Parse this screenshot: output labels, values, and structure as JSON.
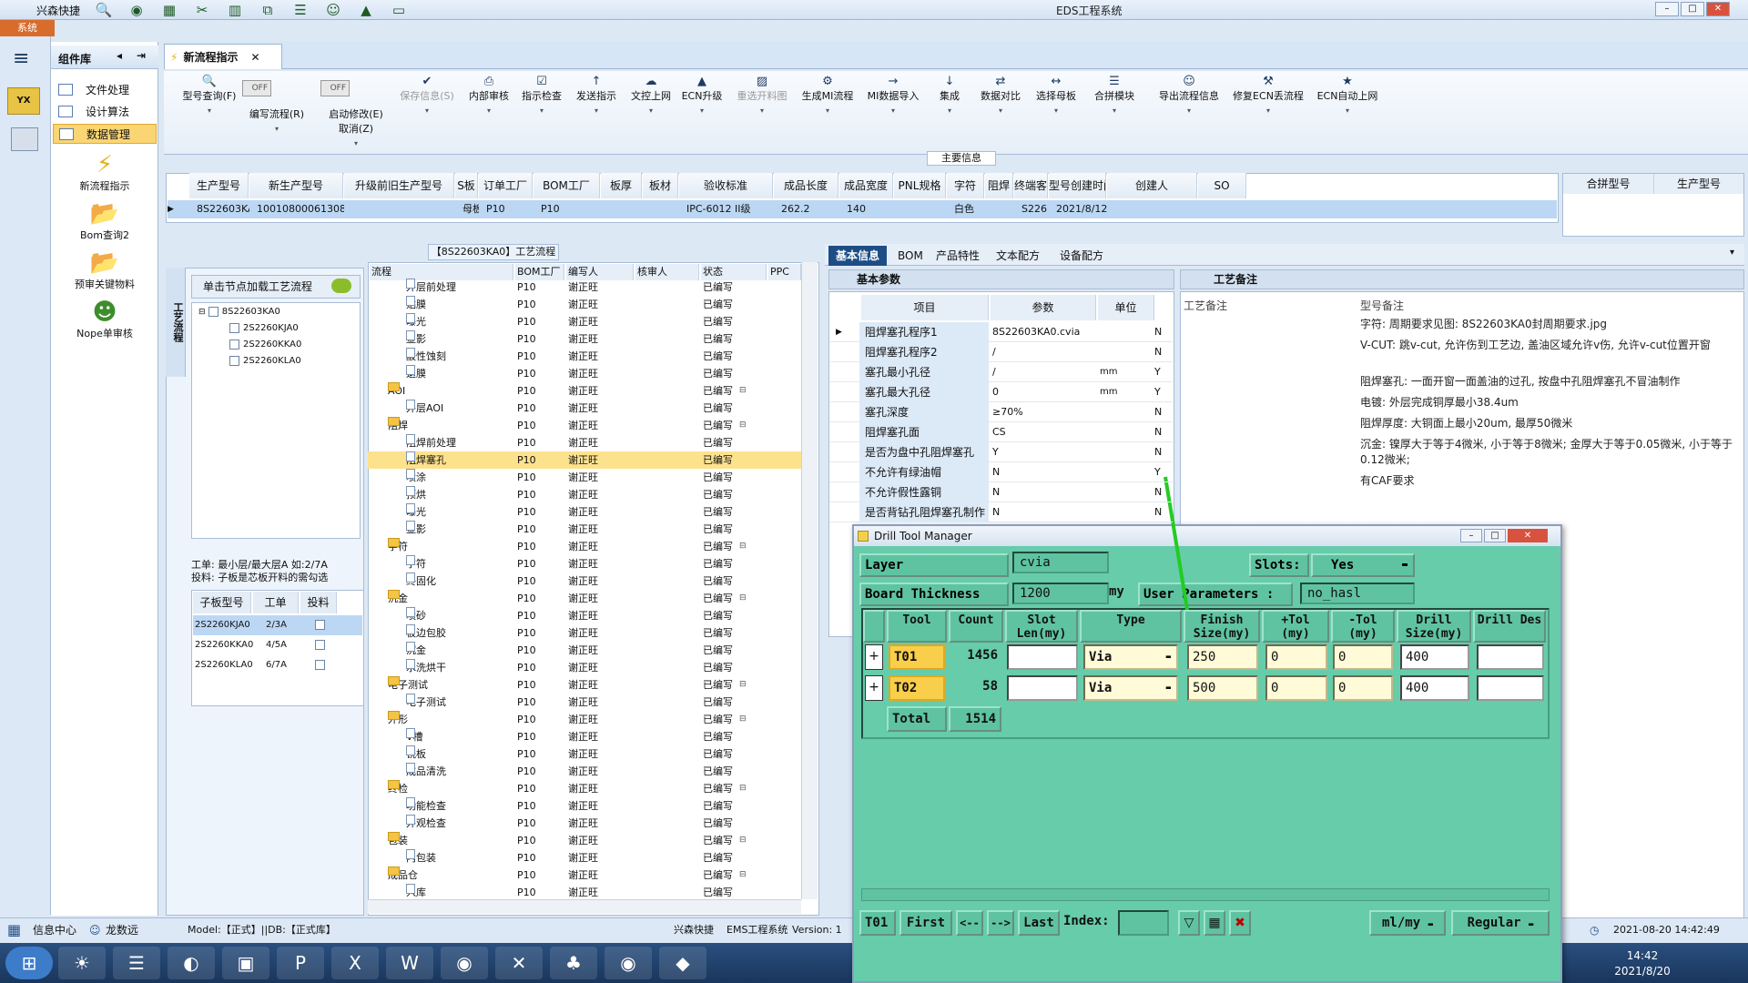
{
  "window": {
    "title": "EDS工程系统",
    "app_menu_label": "兴森快捷",
    "system_tab": "系统"
  },
  "left_panel": {
    "title": "组件库",
    "nav": [
      {
        "label": "文件处理"
      },
      {
        "label": "设计算法"
      },
      {
        "label": "数据管理"
      }
    ],
    "big_items": [
      {
        "label": "新流程指示"
      },
      {
        "label": "Bom查询2"
      },
      {
        "label": "预审关键物料"
      },
      {
        "label": "Nope单审核"
      }
    ]
  },
  "doc_tab": {
    "label": "新流程指示"
  },
  "ribbon": {
    "buttons": [
      {
        "label": "型号查询(F)"
      },
      {
        "label": "编写流程(R)"
      },
      {
        "label": "启动修改(E)",
        "sub": "取消(Z)"
      },
      {
        "label": "保存信息(S)"
      },
      {
        "label": "内部审核"
      },
      {
        "label": "指示检查"
      },
      {
        "label": "发送指示"
      },
      {
        "label": "文控上网"
      },
      {
        "label": "ECN升级"
      },
      {
        "label": "重选开料图"
      },
      {
        "label": "生成MI流程"
      },
      {
        "label": "MI数据导入"
      },
      {
        "label": "集成"
      },
      {
        "label": "数据对比"
      },
      {
        "label": "选择母板"
      },
      {
        "label": "合拼模块"
      },
      {
        "label": "导出流程信息"
      },
      {
        "label": "修复ECN丢流程"
      },
      {
        "label": "ECN自动上网"
      }
    ],
    "toggle_off": "OFF",
    "section_label": "主要信息"
  },
  "main_grid": {
    "headers": [
      "生产型号",
      "新生产型号",
      "升级前旧生产型号",
      "S板",
      "订单工厂",
      "BOM工厂",
      "板厚",
      "板材",
      "验收标准",
      "成品长度",
      "成品宽度",
      "PNL规格",
      "字符",
      "阻焊",
      "终端客户代码",
      "型号创建时间",
      "创建人",
      "SO"
    ],
    "row": [
      "8S22603KA0",
      "10010800061308",
      "",
      "母板",
      "P10",
      "P10",
      "",
      "",
      "IPC-6012 II级",
      "262.2",
      "140",
      "",
      "白色",
      "",
      "S226",
      "2021/8/12",
      "",
      ""
    ]
  },
  "merge_grid": {
    "headers": [
      "合拼型号",
      "生产型号"
    ]
  },
  "tree_panel": {
    "vertical_label": "工艺流程",
    "load_button": "单击节点加载工艺流程",
    "root": "8S22603KA0",
    "children": [
      "2S2260KJA0",
      "2S2260KKA0",
      "2S2260KLA0"
    ],
    "memo": "工单: 最小层/最大层A 如:2/7A\n投料: 子板是芯板开料的需勾选",
    "sub_headers": [
      "子板型号",
      "工单",
      "投料"
    ],
    "sub_rows": [
      {
        "model": "2S2260KJA0",
        "order": "2/3A"
      },
      {
        "model": "2S2260KKA0",
        "order": "4/5A"
      },
      {
        "model": "2S2260KLA0",
        "order": "6/7A"
      }
    ]
  },
  "flow": {
    "title": "【8S22603KA0】工艺流程",
    "headers": [
      "流程",
      "BOM工厂",
      "编写人",
      "核审人",
      "状态",
      "PPC"
    ],
    "rows": [
      {
        "name": "外层前处理",
        "kind": "leaf",
        "f": "P10",
        "w": "谢正旺",
        "s": "已编写"
      },
      {
        "name": "贴膜",
        "kind": "leaf",
        "f": "P10",
        "w": "谢正旺",
        "s": "已编写"
      },
      {
        "name": "曝光",
        "kind": "leaf",
        "f": "P10",
        "w": "谢正旺",
        "s": "已编写"
      },
      {
        "name": "显影",
        "kind": "leaf",
        "f": "P10",
        "w": "谢正旺",
        "s": "已编写"
      },
      {
        "name": "酸性蚀刻",
        "kind": "leaf",
        "f": "P10",
        "w": "谢正旺",
        "s": "已编写"
      },
      {
        "name": "退膜",
        "kind": "leaf",
        "f": "P10",
        "w": "谢正旺",
        "s": "已编写"
      },
      {
        "name": "AOI",
        "kind": "folder",
        "f": "P10",
        "w": "谢正旺",
        "s": "已编写"
      },
      {
        "name": "外层AOI",
        "kind": "leaf",
        "f": "P10",
        "w": "谢正旺",
        "s": "已编写"
      },
      {
        "name": "阻焊",
        "kind": "folder",
        "f": "P10",
        "w": "谢正旺",
        "s": "已编写"
      },
      {
        "name": "阻焊前处理",
        "kind": "leaf",
        "f": "P10",
        "w": "谢正旺",
        "s": "已编写"
      },
      {
        "name": "阻焊塞孔",
        "kind": "leaf",
        "f": "P10",
        "w": "谢正旺",
        "s": "已编写",
        "sel": true
      },
      {
        "name": "喷涂",
        "kind": "leaf",
        "f": "P10",
        "w": "谢正旺",
        "s": "已编写"
      },
      {
        "name": "预烘",
        "kind": "leaf",
        "f": "P10",
        "w": "谢正旺",
        "s": "已编写"
      },
      {
        "name": "曝光",
        "kind": "leaf",
        "f": "P10",
        "w": "谢正旺",
        "s": "已编写"
      },
      {
        "name": "显影",
        "kind": "leaf",
        "f": "P10",
        "w": "谢正旺",
        "s": "已编写"
      },
      {
        "name": "字符",
        "kind": "folder",
        "f": "P10",
        "w": "谢正旺",
        "s": "已编写"
      },
      {
        "name": "字符",
        "kind": "leaf",
        "f": "P10",
        "w": "谢正旺",
        "s": "已编写"
      },
      {
        "name": "终固化",
        "kind": "leaf",
        "f": "P10",
        "w": "谢正旺",
        "s": "已编写"
      },
      {
        "name": "沉金",
        "kind": "folder",
        "f": "P10",
        "w": "谢正旺",
        "s": "已编写"
      },
      {
        "name": "喷砂",
        "kind": "leaf",
        "f": "P10",
        "w": "谢正旺",
        "s": "已编写"
      },
      {
        "name": "板边包胶",
        "kind": "leaf",
        "f": "P10",
        "w": "谢正旺",
        "s": "已编写"
      },
      {
        "name": "沉金",
        "kind": "leaf",
        "f": "P10",
        "w": "谢正旺",
        "s": "已编写"
      },
      {
        "name": "水洗烘干",
        "kind": "leaf",
        "f": "P10",
        "w": "谢正旺",
        "s": "已编写"
      },
      {
        "name": "电子测试",
        "kind": "folder",
        "f": "P10",
        "w": "谢正旺",
        "s": "已编写"
      },
      {
        "name": "电子测试",
        "kind": "leaf",
        "f": "P10",
        "w": "谢正旺",
        "s": "已编写"
      },
      {
        "name": "外形",
        "kind": "folder",
        "f": "P10",
        "w": "谢正旺",
        "s": "已编写"
      },
      {
        "name": "V槽",
        "kind": "leaf",
        "f": "P10",
        "w": "谢正旺",
        "s": "已编写"
      },
      {
        "name": "铣板",
        "kind": "leaf",
        "f": "P10",
        "w": "谢正旺",
        "s": "已编写"
      },
      {
        "name": "成品清洗",
        "kind": "leaf",
        "f": "P10",
        "w": "谢正旺",
        "s": "已编写"
      },
      {
        "name": "终检",
        "kind": "folder",
        "f": "P10",
        "w": "谢正旺",
        "s": "已编写"
      },
      {
        "name": "功能检查",
        "kind": "leaf",
        "f": "P10",
        "w": "谢正旺",
        "s": "已编写"
      },
      {
        "name": "外观检查",
        "kind": "leaf",
        "f": "P10",
        "w": "谢正旺",
        "s": "已编写"
      },
      {
        "name": "包装",
        "kind": "folder",
        "f": "P10",
        "w": "谢正旺",
        "s": "已编写"
      },
      {
        "name": "内包装",
        "kind": "leaf",
        "f": "P10",
        "w": "谢正旺",
        "s": "已编写"
      },
      {
        "name": "成品仓",
        "kind": "folder",
        "f": "P10",
        "w": "谢正旺",
        "s": "已编写"
      },
      {
        "name": "入库",
        "kind": "leaf",
        "f": "P10",
        "w": "谢正旺",
        "s": "已编写"
      }
    ]
  },
  "right_tabs": [
    "基本信息",
    "BOM",
    "产品特性",
    "文本配方",
    "设备配方"
  ],
  "params": {
    "title": "基本参数",
    "headers": [
      "项目",
      "参数",
      "单位"
    ],
    "rows": [
      {
        "name": "阻焊塞孔程序1",
        "val": "8S22603KA0.cvia",
        "unit": "",
        "flag": "N"
      },
      {
        "name": "阻焊塞孔程序2",
        "val": "/",
        "unit": "",
        "flag": "N"
      },
      {
        "name": "塞孔最小孔径",
        "val": "/",
        "unit": "mm",
        "flag": "Y"
      },
      {
        "name": "塞孔最大孔径",
        "val": "0",
        "unit": "mm",
        "flag": "Y"
      },
      {
        "name": "塞孔深度",
        "val": "≥70%",
        "unit": "",
        "flag": "N"
      },
      {
        "name": "阻焊塞孔面",
        "val": "CS",
        "unit": "",
        "flag": "N"
      },
      {
        "name": "是否为盘中孔阻焊塞孔",
        "val": "Y",
        "unit": "",
        "flag": "N"
      },
      {
        "name": "不允许有绿油帽",
        "val": "N",
        "unit": "",
        "flag": "Y"
      },
      {
        "name": "不允许假性露铜",
        "val": "N",
        "unit": "",
        "flag": "N"
      },
      {
        "name": "是否背钻孔阻焊塞孔制作",
        "val": "N",
        "unit": "",
        "flag": "N"
      }
    ]
  },
  "notes": {
    "title": "工艺备注",
    "col1": "工艺备注",
    "col2": "型号备注",
    "lines": [
      "字符: 周期要求见图: 8S22603KA0封周期要求.jpg",
      "V-CUT: 跳v-cut, 允许伤到工艺边, 盖油区域允许v伤, 允许v-cut位置开窗",
      "阻焊塞孔: 一面开窗一面盖油的过孔, 按盘中孔阻焊塞孔不冒油制作",
      "电镀: 外层完成铜厚最小38.4um",
      "阻焊厚度: 大铜面上最小20um, 最厚50微米",
      "沉金: 镍厚大于等于4微米, 小于等于8微米; 金厚大于等于0.05微米, 小于等于0.12微米;",
      "有CAF要求"
    ]
  },
  "dtm": {
    "title": "Drill Tool Manager",
    "layer_label": "Layer",
    "layer_value": "cvia",
    "slots_label": "Slots:",
    "slots_value": "Yes",
    "thickness_label": "Board Thickness",
    "thickness_value": "1200",
    "thickness_unit": "my",
    "user_params_label": "User Parameters :",
    "user_params_value": "no_hasl",
    "headers": [
      "Tool",
      "Count",
      "Slot Len(my)",
      "Type",
      "Finish Size(my)",
      "+Tol (my)",
      "-Tol (my)",
      "Drill Size(my)",
      "Drill Des"
    ],
    "rows": [
      {
        "tool": "T01",
        "count": "1456",
        "slot": "",
        "type": "Via",
        "finish": "250",
        "ptol": "0",
        "mtol": "0",
        "drill": "400",
        "des": ""
      },
      {
        "tool": "T02",
        "count": "58",
        "slot": "",
        "type": "Via",
        "finish": "500",
        "ptol": "0",
        "mtol": "0",
        "drill": "400",
        "des": ""
      }
    ],
    "total_label": "Total",
    "total_count": "1514",
    "footer": {
      "current": "T01",
      "first": "First",
      "prev": "<--",
      "next": "-->",
      "last": "Last",
      "index": "Index:",
      "units": "ml/my",
      "mode": "Regular"
    }
  },
  "status": {
    "info_center": "信息中心",
    "user": "龙数远",
    "model": "Model:【正式】||DB:【正式库】",
    "company": "兴森快捷",
    "system": "EMS工程系统",
    "version": "Version: 1",
    "datetime": "2021-08-20 14:42:49"
  },
  "taskbar": {
    "time": "14:42",
    "date": "2021/8/20"
  },
  "colors": {
    "accent": "#1e4d86",
    "dtm_bg": "#66ccaa",
    "select_yellow": "#fde28d",
    "arrow": "#22cc22"
  }
}
